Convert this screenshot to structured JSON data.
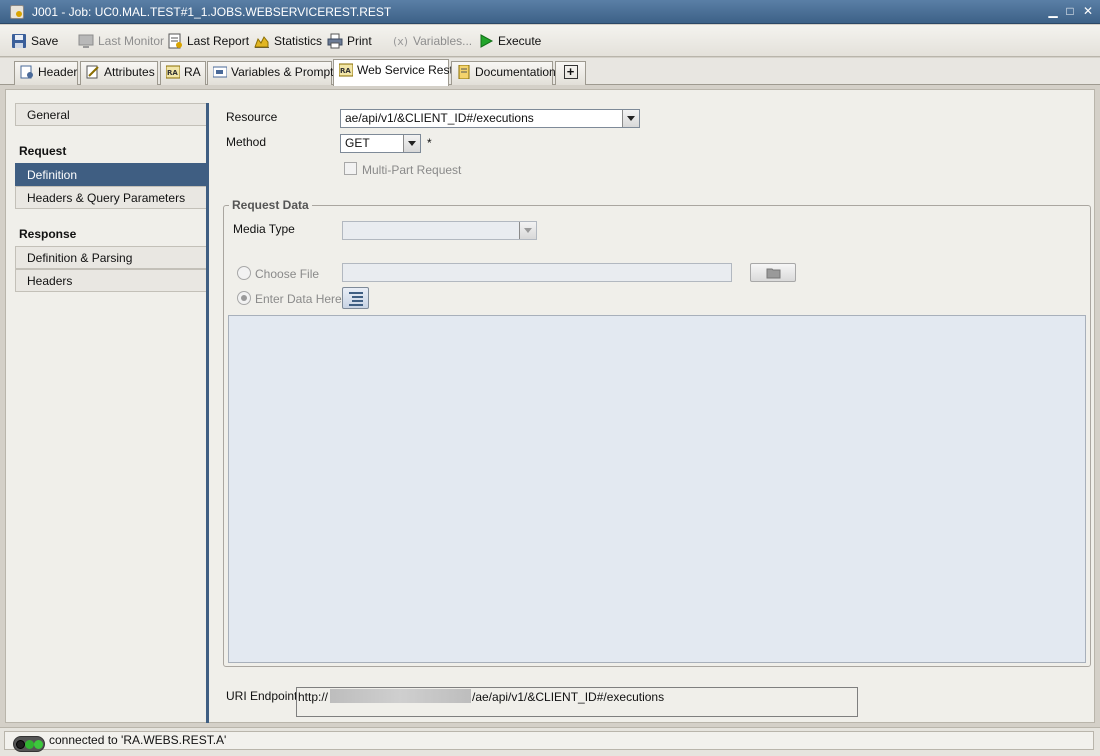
{
  "window": {
    "title": "J001 - Job: UC0.MAL.TEST#1_1.JOBS.WEBSERVICEREST.REST",
    "minimize_glyph": "▁",
    "maximize_glyph": "□",
    "close_glyph": "✕"
  },
  "toolbar": {
    "save_label": "Save",
    "last_monitor_label": "Last Monitor",
    "last_report_label": "Last Report",
    "statistics_label": "Statistics",
    "print_label": "Print",
    "variables_label": "Variables...",
    "execute_label": "Execute"
  },
  "tabs": [
    {
      "label": "Header"
    },
    {
      "label": "Attributes"
    },
    {
      "label": "RA"
    },
    {
      "label": "Variables & Prompts"
    },
    {
      "label": "Web Service Rest",
      "active": true
    },
    {
      "label": "Documentation"
    }
  ],
  "add_tab_glyph": "+",
  "sidebar": {
    "general": "General",
    "request_heading": "Request",
    "definition": "Definition",
    "headers_query": "Headers & Query Parameters",
    "response_heading": "Response",
    "definition_parsing": "Definition & Parsing",
    "headers": "Headers"
  },
  "form": {
    "resource_label": "Resource",
    "resource_value": "ae/api/v1/&CLIENT_ID#/executions",
    "method_label": "Method",
    "method_value": "GET",
    "required_marker": "*",
    "multipart_label": "Multi-Part Request"
  },
  "request_data": {
    "title": "Request Data",
    "media_type_label": "Media Type",
    "media_type_value": "",
    "choose_file_label": "Choose File",
    "enter_data_label": "Enter Data Here"
  },
  "uri": {
    "label": "URI Endpoint",
    "prefix": "http://",
    "suffix": "/ae/api/v1/&CLIENT_ID#/executions"
  },
  "status": {
    "text": "connected to 'RA.WEBS.REST.A'"
  },
  "colors": {
    "accent": "#3f5e82",
    "led_left": "#1f1f1f",
    "led_mid": "#32b432",
    "led_right": "#3cc83c"
  }
}
